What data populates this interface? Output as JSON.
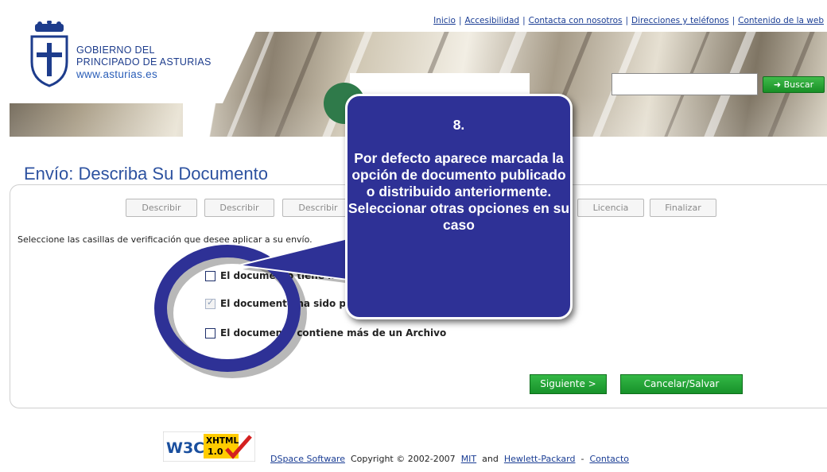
{
  "header": {
    "logo_line1": "GOBIERNO DEL",
    "logo_line2": "PRINCIPADO DE ASTURIAS",
    "logo_url": "www.asturias.es",
    "top_links": [
      "Inicio",
      "Accesibilidad",
      "Contacta con nosotros",
      "Direcciones y teléfonos",
      "Contenido de la web"
    ],
    "search_placeholder": "",
    "search_button": "Buscar"
  },
  "page": {
    "title": "Envío: Describa Su Documento",
    "steps": [
      "Describir",
      "Describir",
      "Describir",
      "Licencia",
      "Finalizar"
    ],
    "instruction": "Seleccione las casillas de verificación que desee aplicar a su envío.",
    "options": [
      {
        "label": "El documento tiene más de un título, p.e. un título traducido",
        "checked": false
      },
      {
        "label": "El documento ha sido publicado o distribuido anteriormente",
        "checked": true
      },
      {
        "label": "El documento contiene más de un Archivo",
        "checked": false
      }
    ],
    "next_button": "Siguiente >",
    "cancel_button": "Cancelar/Salvar"
  },
  "footer": {
    "dspace": "DSpace Software",
    "copyright": "Copyright © 2002-2007",
    "mit": "MIT",
    "and": "and",
    "hp": "Hewlett-Packard",
    "dash": "-",
    "contact": "Contacto",
    "badge_w3c": "W3C",
    "badge_xhtml": "XHTML",
    "badge_version": "1.0"
  },
  "callout": {
    "number": "8.",
    "text": "Por defecto aparece marcada la opción de documento publicado o distribuido anteriormente. Seleccionar otras opciones en su caso"
  },
  "colors": {
    "accent": "#2e3196",
    "link": "#1a3d94",
    "green_button": "#17922a",
    "title": "#2d52a0"
  }
}
